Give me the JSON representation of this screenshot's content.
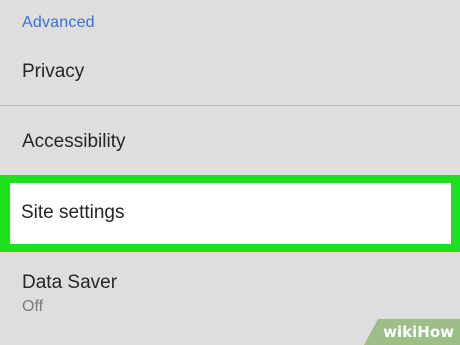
{
  "settings": {
    "section_header": "Advanced",
    "items": [
      {
        "label": "Privacy"
      },
      {
        "label": "Accessibility"
      },
      {
        "label": "Site settings"
      },
      {
        "label": "Data Saver",
        "sublabel": "Off"
      }
    ]
  },
  "highlight": {
    "color": "#1ee01e"
  },
  "watermark": {
    "text": "wikiHow"
  },
  "colors": {
    "background": "#dedede",
    "section_header": "#3b6fd0",
    "text": "#262626",
    "sublabel": "#7a7a7a"
  }
}
